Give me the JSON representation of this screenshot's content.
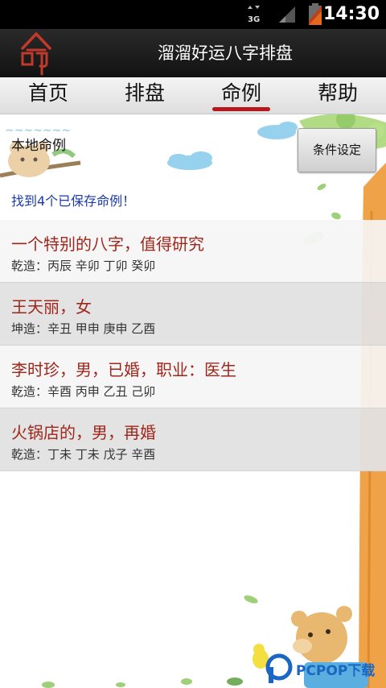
{
  "status_bar": {
    "network_label": "3G",
    "time": "14:30",
    "icons": [
      "data-arrows-icon",
      "signal-icon",
      "battery-icon"
    ]
  },
  "header": {
    "logo_glyph": "命",
    "title": "溜溜好运八字排盘"
  },
  "tabs": [
    {
      "label": "首页",
      "active": false
    },
    {
      "label": "排盘",
      "active": false
    },
    {
      "label": "命例",
      "active": true
    },
    {
      "label": "帮助",
      "active": false
    }
  ],
  "main": {
    "section_title": "本地命例",
    "filter_button_label": "条件设定",
    "found_text": "找到4个已保存命例！",
    "cases": [
      {
        "title": "一个特别的八字，值得研究",
        "detail": "乾造：丙辰 辛卯 丁卯 癸卯"
      },
      {
        "title": "王天丽，女",
        "detail": "坤造：辛丑 甲申 庚申 乙酉"
      },
      {
        "title": "李时珍，男，已婚，职业：医生",
        "detail": "乾造：辛酉 丙申 乙丑 己卯"
      },
      {
        "title": "火锅店的，男，再婚",
        "detail": "乾造：丁未 丁未 戊子 辛酉"
      }
    ]
  },
  "watermark": {
    "text": "PCPOP下载"
  },
  "colors": {
    "accent": "#b3181c",
    "case_title": "#a0261a",
    "found_text": "#1a3aa8",
    "watermark": "#1a66c2"
  }
}
